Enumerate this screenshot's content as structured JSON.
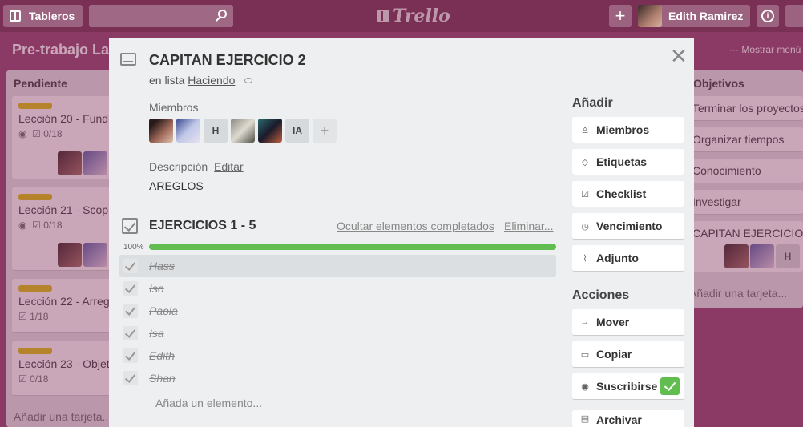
{
  "topbar": {
    "boards_label": "Tableros",
    "search_placeholder": "",
    "logo_text": "Trello",
    "add_label": "+",
    "user_name": "Edith Ramirez"
  },
  "board": {
    "title": "Pre-trabajo La",
    "menu_link": "Mostrar menú"
  },
  "left_list": {
    "title": "Pendiente",
    "cards": [
      {
        "title": "Lección 20 - Fund",
        "badge": "0/18"
      },
      {
        "title": "Lección 21 - Scop",
        "badge": "0/18"
      },
      {
        "title": "Lección 22 - Arreg",
        "badge": "1/18"
      },
      {
        "title": "Lección 23 - Objet",
        "badge": "0/18"
      }
    ],
    "add_card": "Añadir una tarjeta..."
  },
  "right_list": {
    "title": "Objetivos",
    "cards": [
      {
        "title": "Terminar los proyectos"
      },
      {
        "title": "Organizar tiempos"
      },
      {
        "title": "Conocimiento"
      },
      {
        "title": "Investigar"
      },
      {
        "title": "CAPITAN EJERCICIO"
      }
    ],
    "member_initial": "H",
    "add_card": "Añadir una tarjeta..."
  },
  "modal": {
    "title": "CAPITAN EJERCICIO 2",
    "in_list_prefix": "en lista",
    "list_name": "Haciendo",
    "members_heading": "Miembros",
    "members": [
      {
        "kind": "photo"
      },
      {
        "kind": "photo"
      },
      {
        "kind": "initials",
        "label": "H"
      },
      {
        "kind": "photo"
      },
      {
        "kind": "photo"
      },
      {
        "kind": "initials",
        "label": "IA"
      }
    ],
    "add_member": "+",
    "description_heading": "Descripción",
    "description_edit": "Editar",
    "description_text": "AREGLOS",
    "checklist": {
      "title": "EJERCICIOS 1 - 5",
      "hide_completed": "Ocultar elementos completados",
      "delete": "Eliminar...",
      "progress_label": "100%",
      "progress": 1.0,
      "items": [
        "Hass",
        "Iso",
        "Paola",
        "Isa",
        "Edith",
        "Shan"
      ],
      "add_item": "Añada un elemento..."
    },
    "sidebar": {
      "add_heading": "Añadir",
      "add_buttons": [
        {
          "label": "Miembros",
          "icon": "person-icon"
        },
        {
          "label": "Etiquetas",
          "icon": "tag-icon"
        },
        {
          "label": "Checklist",
          "icon": "checklist-icon"
        },
        {
          "label": "Vencimiento",
          "icon": "clock-icon"
        },
        {
          "label": "Adjunto",
          "icon": "paperclip-icon"
        }
      ],
      "actions_heading": "Acciones",
      "action_buttons": [
        {
          "label": "Mover",
          "icon": "arrow-right-icon"
        },
        {
          "label": "Copiar",
          "icon": "card-icon"
        },
        {
          "label": "Suscribirse",
          "icon": "eye-icon"
        },
        {
          "label": "Archivar",
          "icon": "archive-icon"
        }
      ]
    }
  },
  "colors": {
    "board_bg": "#8a3a64",
    "topbar": "#7a2f55",
    "progress_green": "#61bd4f",
    "label_yellow": "#d8c000"
  }
}
